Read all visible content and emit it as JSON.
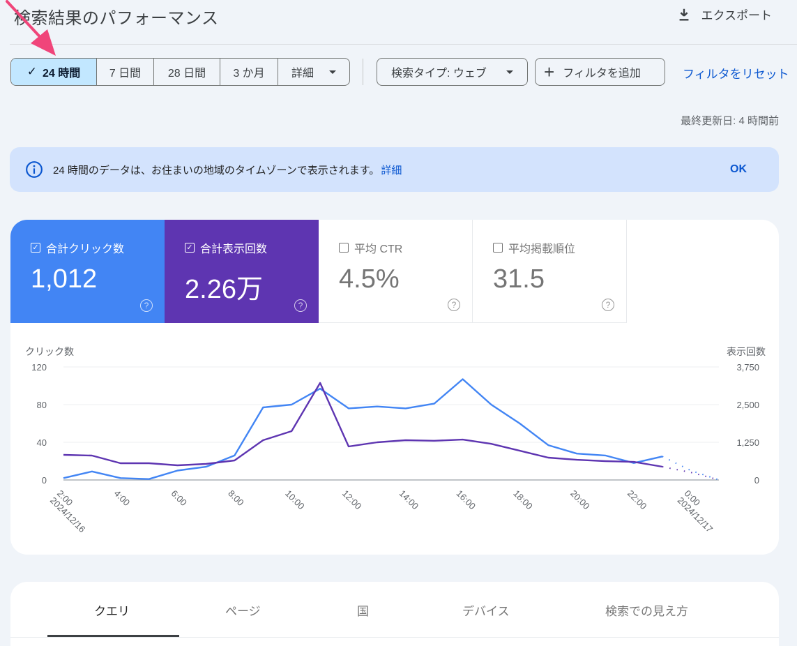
{
  "header": {
    "title": "検索結果のパフォーマンス",
    "export_label": "エクスポート"
  },
  "date_range": {
    "options": [
      {
        "label": "24 時間",
        "active": true
      },
      {
        "label": "7 日間",
        "active": false
      },
      {
        "label": "28 日間",
        "active": false
      },
      {
        "label": "3 か月",
        "active": false
      }
    ],
    "more_label": "詳細"
  },
  "filters": {
    "search_type_label": "検索タイプ: ウェブ",
    "add_filter_label": "フィルタを追加",
    "reset_label": "フィルタをリセット"
  },
  "last_updated": "最終更新日: 4 時間前",
  "banner": {
    "message": "24 時間のデータは、お住まいの地域のタイムゾーンで表示されます。",
    "link_label": "詳細",
    "ok_label": "OK"
  },
  "metrics": [
    {
      "label": "合計クリック数",
      "value": "1,012",
      "checked": true,
      "color": "#4285f4"
    },
    {
      "label": "合計表示回数",
      "value": "2.26万",
      "checked": true,
      "color": "#5e35b1"
    },
    {
      "label": "平均 CTR",
      "value": "4.5%",
      "checked": false
    },
    {
      "label": "平均掲載順位",
      "value": "31.5",
      "checked": false
    }
  ],
  "chart_data": {
    "type": "line",
    "left_axis_title": "クリック数",
    "right_axis_title": "表示回数",
    "left_ylim": [
      0,
      120
    ],
    "right_ylim": [
      0,
      3750
    ],
    "left_ticks": [
      "0",
      "40",
      "80",
      "120"
    ],
    "right_ticks": [
      "0",
      "1,250",
      "2,500",
      "3,750"
    ],
    "grid": true,
    "x_hours": [
      2,
      3,
      4,
      5,
      6,
      7,
      8,
      9,
      10,
      11,
      12,
      13,
      14,
      15,
      16,
      17,
      18,
      19,
      20,
      21,
      22,
      23
    ],
    "x_tick_labels": [
      {
        "hour": 2,
        "label": "2:00",
        "date": "2024/12/16"
      },
      {
        "hour": 4,
        "label": "4:00"
      },
      {
        "hour": 6,
        "label": "6:00"
      },
      {
        "hour": 8,
        "label": "8:00"
      },
      {
        "hour": 10,
        "label": "10:00"
      },
      {
        "hour": 12,
        "label": "12:00"
      },
      {
        "hour": 14,
        "label": "14:00"
      },
      {
        "hour": 16,
        "label": "16:00"
      },
      {
        "hour": 18,
        "label": "18:00"
      },
      {
        "hour": 20,
        "label": "20:00"
      },
      {
        "hour": 22,
        "label": "22:00"
      },
      {
        "hour": 24,
        "label": "0:00",
        "date": "2024/12/17"
      }
    ],
    "x_range_hours": [
      2,
      25
    ],
    "series": [
      {
        "name": "クリック数",
        "axis": "left",
        "color": "#4285f4",
        "values": [
          2,
          9,
          2,
          1,
          10,
          14,
          26,
          77,
          80,
          97,
          76,
          78,
          76,
          81,
          107,
          80,
          60,
          37,
          28,
          26,
          18,
          25
        ],
        "projection": {
          "hours": [
            23,
            24,
            25
          ],
          "values": [
            25,
            10,
            0
          ]
        }
      },
      {
        "name": "表示回数",
        "axis": "right",
        "color": "#5e35b1",
        "values": [
          833,
          810,
          555,
          555,
          486,
          532,
          648,
          1320,
          1620,
          3220,
          1110,
          1250,
          1320,
          1300,
          1340,
          1200,
          970,
          740,
          670,
          625,
          600,
          440
        ],
        "projection": {
          "hours": [
            23,
            24,
            25
          ],
          "values": [
            440,
            250,
            0
          ]
        }
      }
    ]
  },
  "tabs": [
    {
      "label": "クエリ",
      "active": true
    },
    {
      "label": "ページ",
      "active": false
    },
    {
      "label": "国",
      "active": false
    },
    {
      "label": "デバイス",
      "active": false
    },
    {
      "label": "検索での見え方",
      "active": false
    }
  ],
  "annotation": {
    "arrow_color": "#f0457a"
  }
}
